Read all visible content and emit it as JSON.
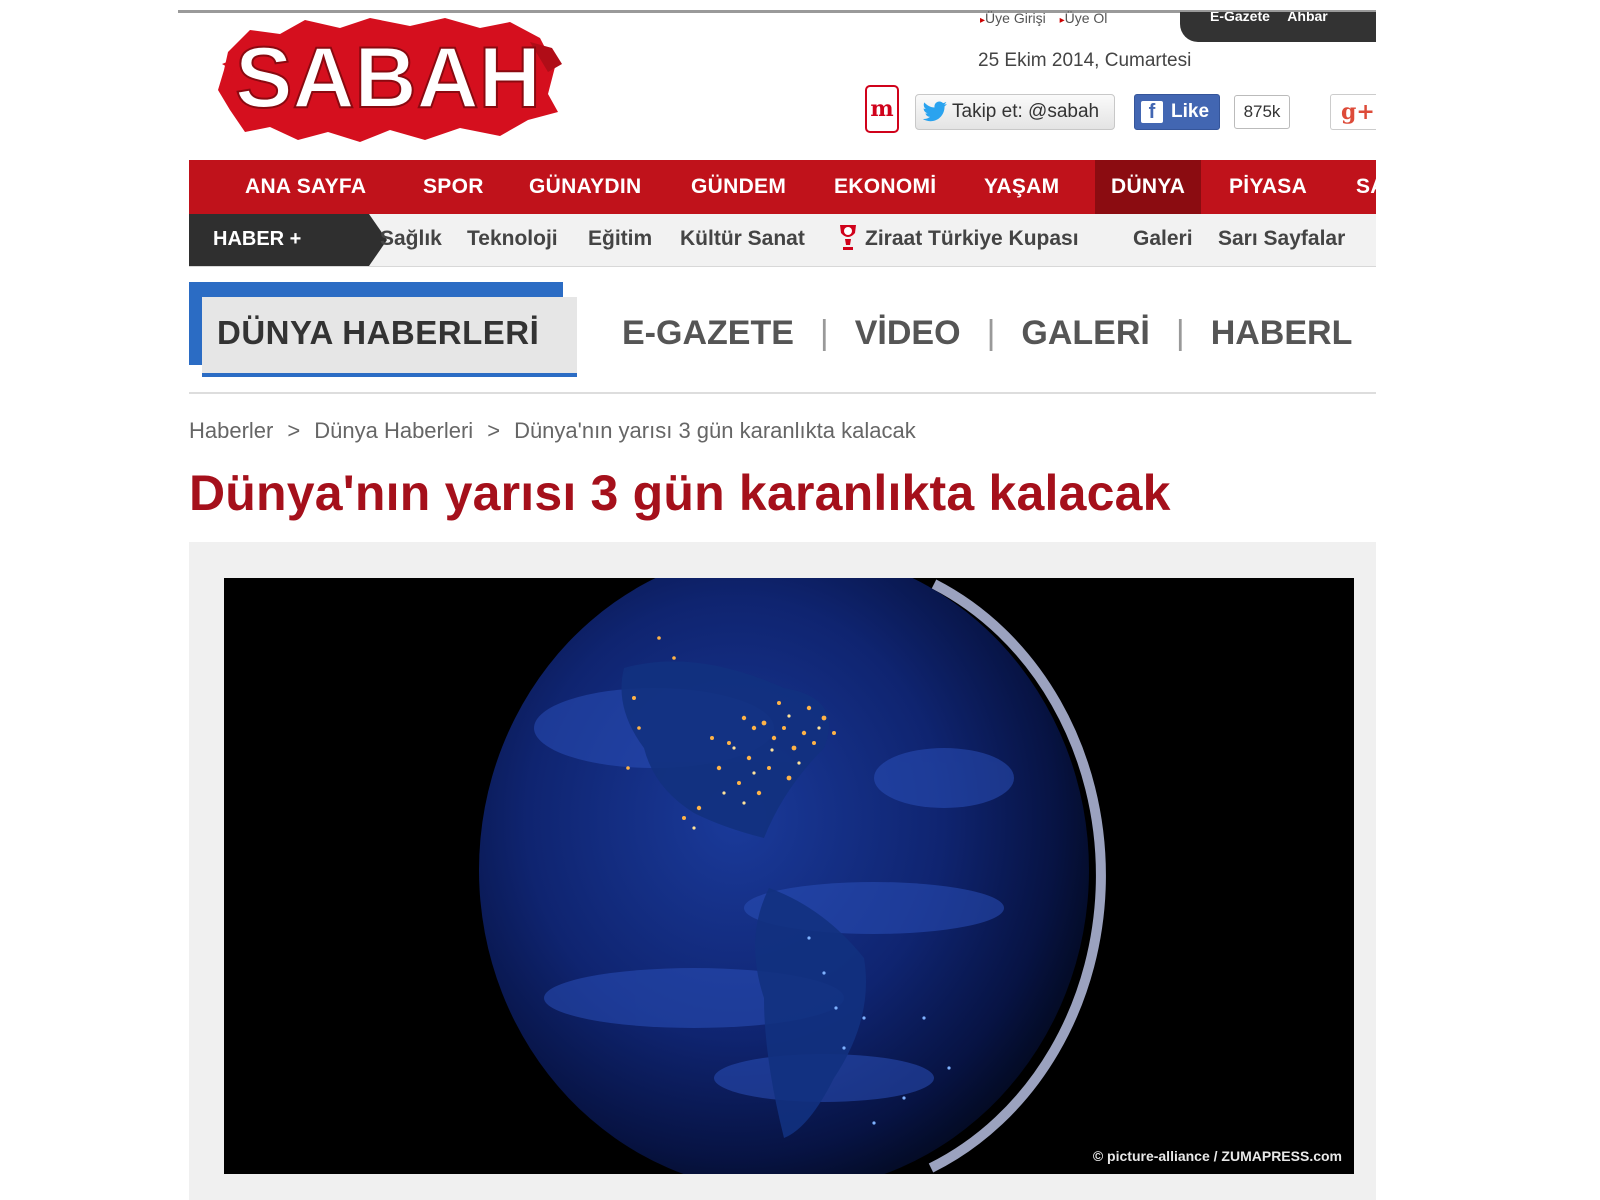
{
  "header": {
    "logo_text": "SABAH",
    "top_links": [
      "Üye Girişi",
      "Üye Ol"
    ],
    "top_dark_links": [
      "E-Gazete",
      "Ahbar"
    ],
    "date": "25 Ekim 2014, Cumartesi",
    "twitter_label": "Takip et: @sabah",
    "facebook_label": "Like",
    "facebook_count": "875k",
    "gplus_label": "g+",
    "m_icon_label": "m"
  },
  "main_nav": {
    "items": [
      "ANA SAYFA",
      "SPOR",
      "GÜNAYDIN",
      "GÜNDEM",
      "EKONOMİ",
      "YAŞAM",
      "DÜNYA",
      "PİYASA",
      "SA"
    ],
    "active": "DÜNYA"
  },
  "sub_nav": {
    "badge": "HABER +",
    "items": [
      "Sağlık",
      "Teknoloji",
      "Eğitim",
      "Kültür Sanat",
      "Ziraat Türkiye Kupası",
      "Galeri",
      "Sarı Sayfalar"
    ]
  },
  "section": {
    "title": "DÜNYA HABERLERİ",
    "links": [
      "E-GAZETE",
      "VİDEO",
      "GALERİ",
      "HABERL"
    ]
  },
  "breadcrumb": [
    "Haberler",
    "Dünya Haberleri",
    "Dünya'nın yarısı 3 gün karanlıkta kalacak"
  ],
  "article": {
    "headline": "Dünya'nın yarısı 3 gün karanlıkta kalacak",
    "image_credit": "© picture-alliance / ZUMAPRESS.com"
  },
  "colors": {
    "brand_red": "#c0121b",
    "active_nav": "#8b0c11",
    "headline_red": "#a5101b",
    "section_blue": "#2b6cc4"
  }
}
